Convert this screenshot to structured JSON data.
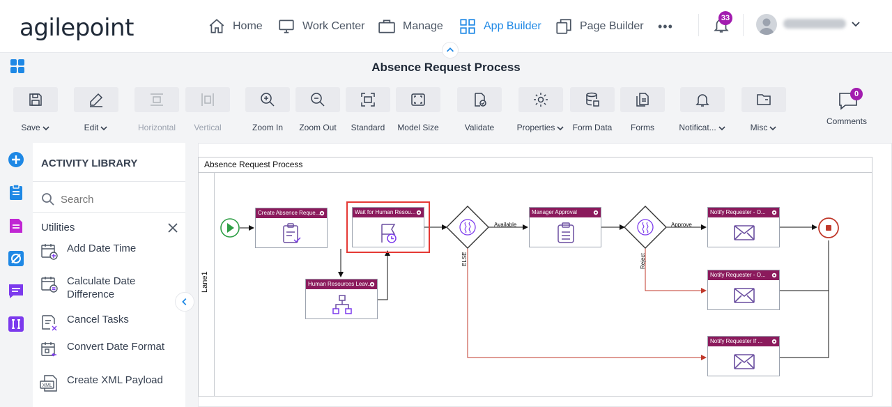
{
  "brand": "agilepoint",
  "nav": {
    "home": "Home",
    "work_center": "Work Center",
    "manage": "Manage",
    "app_builder": "App Builder",
    "page_builder": "Page Builder",
    "more": "•••",
    "notification_count": "33",
    "accent": "#1e88e5"
  },
  "process_title": "Absence Request Process",
  "toolbar": {
    "save": "Save",
    "edit": "Edit",
    "horizontal": "Horizontal",
    "vertical": "Vertical",
    "zoom_in": "Zoom In",
    "zoom_out": "Zoom Out",
    "standard": "Standard",
    "model_size": "Model Size",
    "validate": "Validate",
    "properties": "Properties",
    "form_data": "Form Data",
    "forms": "Forms",
    "notifications": "Notificat...",
    "misc": "Misc",
    "comments": "Comments",
    "comment_count": "0"
  },
  "library": {
    "title": "ACTIVITY LIBRARY",
    "search_placeholder": "Search",
    "section": "Utilities",
    "items": [
      "Add Date Time",
      "Calculate Date Difference",
      "Cancel Tasks",
      "Convert Date Format",
      "Create XML Payload"
    ]
  },
  "canvas": {
    "pool_title": "Absence Request Process",
    "lane": "Lane1",
    "activities": {
      "create_request": "Create Absence Reque...",
      "wait_hr": "Wait for Human Resou...",
      "hr_leave": "Human Resources Leav...",
      "manager_approval": "Manager Approval",
      "notify_1": "Notify Requester - O...",
      "notify_2": "Notify Requester - O...",
      "notify_3": "Notify Requester If ..."
    },
    "flow_labels": {
      "available": "Available",
      "else": "ELSE",
      "approve": "Approve",
      "reject": "Reject"
    },
    "header_color": "#8b1a5c"
  }
}
